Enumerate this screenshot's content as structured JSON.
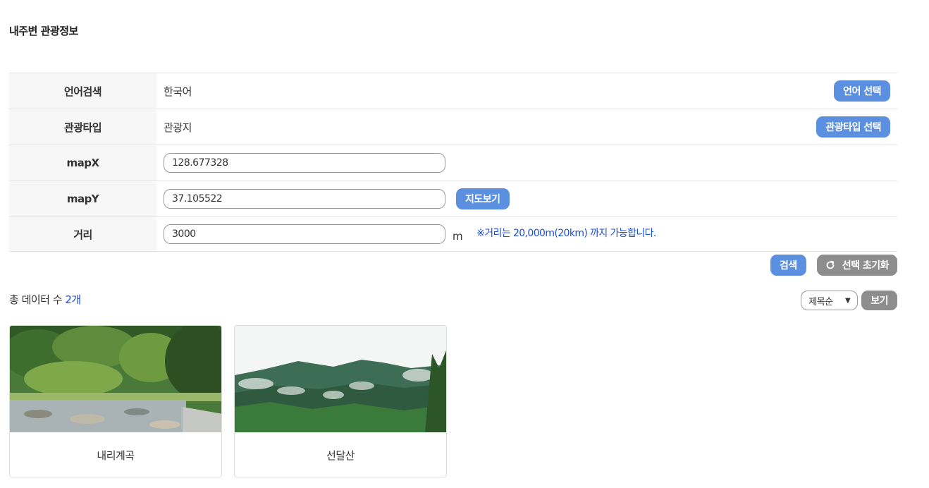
{
  "page": {
    "title": "내주변 관광정보"
  },
  "form": {
    "language": {
      "label": "언어검색",
      "value": "한국어",
      "button": "언어 선택"
    },
    "tour_type": {
      "label": "관광타입",
      "value": "관광지",
      "button": "관광타입 선택"
    },
    "map_x": {
      "label": "mapX",
      "value": "128.677328"
    },
    "map_y": {
      "label": "mapY",
      "value": "37.105522",
      "button": "지도보기"
    },
    "distance": {
      "label": "거리",
      "value": "3000",
      "unit": "m",
      "note": "※거리는 20,000m(20km) 까지 가능합니다."
    }
  },
  "actions": {
    "search": "검색",
    "reset": "선택 초기화"
  },
  "results": {
    "total_prefix": "총 데이터 수 ",
    "total_count": "2개",
    "sort": {
      "selected": "제목순"
    },
    "view_button": "보기",
    "items": [
      {
        "title": "내리계곡",
        "image": "valley-photo"
      },
      {
        "title": "선달산",
        "image": "mountain-photo"
      }
    ]
  },
  "colors": {
    "accent": "#5b8fe0",
    "secondary": "#8d8d8d",
    "note": "#1a4fd6"
  }
}
